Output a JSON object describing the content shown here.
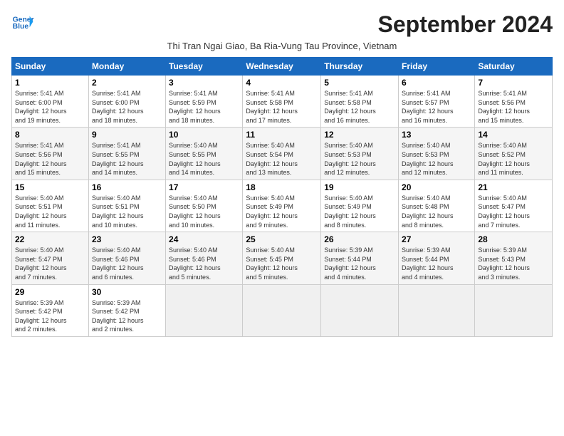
{
  "header": {
    "logo_line1": "General",
    "logo_line2": "Blue",
    "title": "September 2024",
    "subtitle": "Thi Tran Ngai Giao, Ba Ria-Vung Tau Province, Vietnam"
  },
  "days_of_week": [
    "Sunday",
    "Monday",
    "Tuesday",
    "Wednesday",
    "Thursday",
    "Friday",
    "Saturday"
  ],
  "weeks": [
    [
      {
        "day": "1",
        "info": "Sunrise: 5:41 AM\nSunset: 6:00 PM\nDaylight: 12 hours\nand 19 minutes."
      },
      {
        "day": "2",
        "info": "Sunrise: 5:41 AM\nSunset: 6:00 PM\nDaylight: 12 hours\nand 18 minutes."
      },
      {
        "day": "3",
        "info": "Sunrise: 5:41 AM\nSunset: 5:59 PM\nDaylight: 12 hours\nand 18 minutes."
      },
      {
        "day": "4",
        "info": "Sunrise: 5:41 AM\nSunset: 5:58 PM\nDaylight: 12 hours\nand 17 minutes."
      },
      {
        "day": "5",
        "info": "Sunrise: 5:41 AM\nSunset: 5:58 PM\nDaylight: 12 hours\nand 16 minutes."
      },
      {
        "day": "6",
        "info": "Sunrise: 5:41 AM\nSunset: 5:57 PM\nDaylight: 12 hours\nand 16 minutes."
      },
      {
        "day": "7",
        "info": "Sunrise: 5:41 AM\nSunset: 5:56 PM\nDaylight: 12 hours\nand 15 minutes."
      }
    ],
    [
      {
        "day": "8",
        "info": "Sunrise: 5:41 AM\nSunset: 5:56 PM\nDaylight: 12 hours\nand 15 minutes."
      },
      {
        "day": "9",
        "info": "Sunrise: 5:41 AM\nSunset: 5:55 PM\nDaylight: 12 hours\nand 14 minutes."
      },
      {
        "day": "10",
        "info": "Sunrise: 5:40 AM\nSunset: 5:55 PM\nDaylight: 12 hours\nand 14 minutes."
      },
      {
        "day": "11",
        "info": "Sunrise: 5:40 AM\nSunset: 5:54 PM\nDaylight: 12 hours\nand 13 minutes."
      },
      {
        "day": "12",
        "info": "Sunrise: 5:40 AM\nSunset: 5:53 PM\nDaylight: 12 hours\nand 12 minutes."
      },
      {
        "day": "13",
        "info": "Sunrise: 5:40 AM\nSunset: 5:53 PM\nDaylight: 12 hours\nand 12 minutes."
      },
      {
        "day": "14",
        "info": "Sunrise: 5:40 AM\nSunset: 5:52 PM\nDaylight: 12 hours\nand 11 minutes."
      }
    ],
    [
      {
        "day": "15",
        "info": "Sunrise: 5:40 AM\nSunset: 5:51 PM\nDaylight: 12 hours\nand 11 minutes."
      },
      {
        "day": "16",
        "info": "Sunrise: 5:40 AM\nSunset: 5:51 PM\nDaylight: 12 hours\nand 10 minutes."
      },
      {
        "day": "17",
        "info": "Sunrise: 5:40 AM\nSunset: 5:50 PM\nDaylight: 12 hours\nand 10 minutes."
      },
      {
        "day": "18",
        "info": "Sunrise: 5:40 AM\nSunset: 5:49 PM\nDaylight: 12 hours\nand 9 minutes."
      },
      {
        "day": "19",
        "info": "Sunrise: 5:40 AM\nSunset: 5:49 PM\nDaylight: 12 hours\nand 8 minutes."
      },
      {
        "day": "20",
        "info": "Sunrise: 5:40 AM\nSunset: 5:48 PM\nDaylight: 12 hours\nand 8 minutes."
      },
      {
        "day": "21",
        "info": "Sunrise: 5:40 AM\nSunset: 5:47 PM\nDaylight: 12 hours\nand 7 minutes."
      }
    ],
    [
      {
        "day": "22",
        "info": "Sunrise: 5:40 AM\nSunset: 5:47 PM\nDaylight: 12 hours\nand 7 minutes."
      },
      {
        "day": "23",
        "info": "Sunrise: 5:40 AM\nSunset: 5:46 PM\nDaylight: 12 hours\nand 6 minutes."
      },
      {
        "day": "24",
        "info": "Sunrise: 5:40 AM\nSunset: 5:46 PM\nDaylight: 12 hours\nand 5 minutes."
      },
      {
        "day": "25",
        "info": "Sunrise: 5:40 AM\nSunset: 5:45 PM\nDaylight: 12 hours\nand 5 minutes."
      },
      {
        "day": "26",
        "info": "Sunrise: 5:39 AM\nSunset: 5:44 PM\nDaylight: 12 hours\nand 4 minutes."
      },
      {
        "day": "27",
        "info": "Sunrise: 5:39 AM\nSunset: 5:44 PM\nDaylight: 12 hours\nand 4 minutes."
      },
      {
        "day": "28",
        "info": "Sunrise: 5:39 AM\nSunset: 5:43 PM\nDaylight: 12 hours\nand 3 minutes."
      }
    ],
    [
      {
        "day": "29",
        "info": "Sunrise: 5:39 AM\nSunset: 5:42 PM\nDaylight: 12 hours\nand 2 minutes."
      },
      {
        "day": "30",
        "info": "Sunrise: 5:39 AM\nSunset: 5:42 PM\nDaylight: 12 hours\nand 2 minutes."
      },
      {
        "day": "",
        "info": ""
      },
      {
        "day": "",
        "info": ""
      },
      {
        "day": "",
        "info": ""
      },
      {
        "day": "",
        "info": ""
      },
      {
        "day": "",
        "info": ""
      }
    ]
  ]
}
